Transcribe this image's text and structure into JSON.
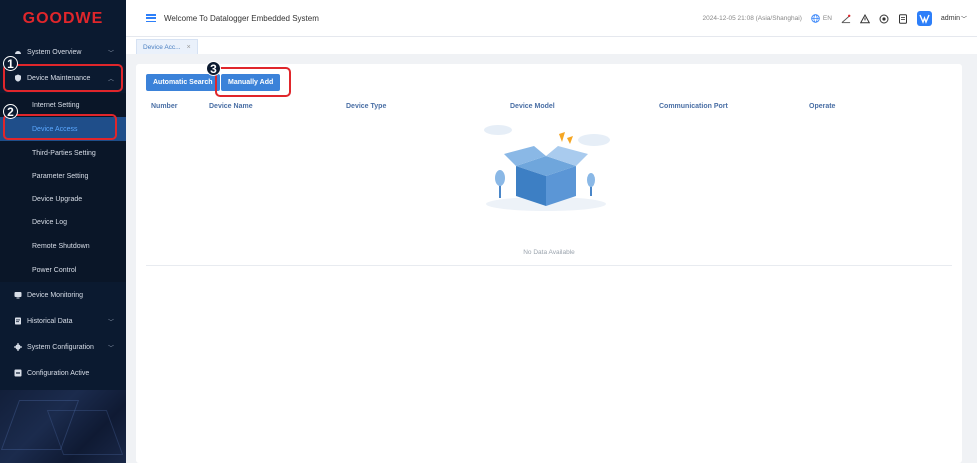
{
  "app": {
    "logo_text": "GOODWE",
    "title": "Welcome To Datalogger Embedded System"
  },
  "header": {
    "datetime": "2024-12-05 21:08 (Asia/Shanghai)",
    "language": "EN",
    "user": "admin"
  },
  "sidebar": {
    "system_overview": "System Overview",
    "device_maintenance": "Device Maintenance",
    "sub_items": [
      "Internet Setting",
      "Device Access",
      "Third-Parties Setting",
      "Parameter Setting",
      "Device Upgrade",
      "Device Log",
      "Remote Shutdown",
      "Power Control"
    ],
    "device_monitoring": "Device Monitoring",
    "historical_data": "Historical Data",
    "system_configuration": "System Configuration",
    "configuration_active": "Configuration Active"
  },
  "tabs": [
    {
      "label": "Device Acc...",
      "close": "×"
    }
  ],
  "toolbar": {
    "auto_search": "Automatic Search",
    "manual_add": "Manually Add"
  },
  "table": {
    "columns": [
      "Number",
      "Device Name",
      "Device Type",
      "Device Model",
      "Communication Port",
      "Operate"
    ],
    "rows": [],
    "empty_text": "No Data Available"
  },
  "annotations": {
    "step1": "1",
    "step2": "2",
    "step3": "3"
  },
  "colors": {
    "sidebar_bg": "#0b1a30",
    "brand_red": "#e0262b",
    "accent_blue": "#2d7ff9",
    "button_blue": "#3b82d9",
    "highlight_red": "#e0262b"
  }
}
